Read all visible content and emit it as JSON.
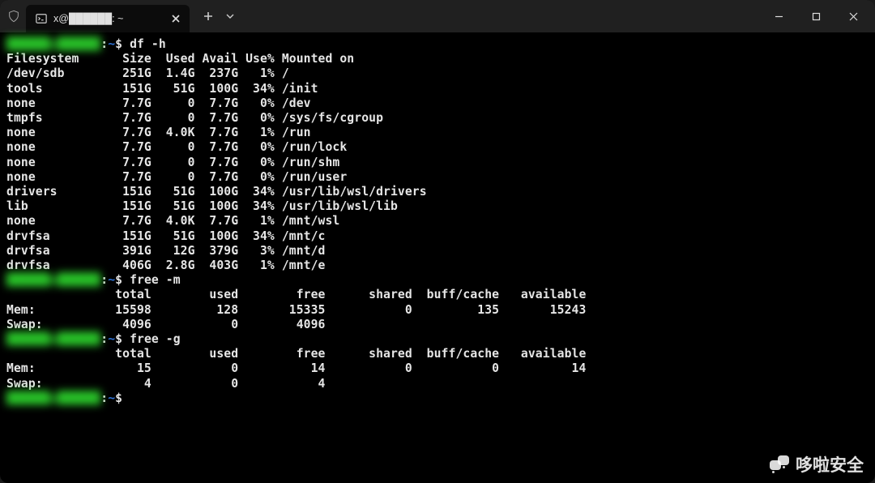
{
  "tab": {
    "title": "x@██████: ~"
  },
  "user": "██████",
  "host": "██████",
  "path": "~",
  "commands": {
    "c1": "df -h",
    "c2": "free -m",
    "c3": "free -g"
  },
  "df": {
    "header": [
      "Filesystem",
      "Size",
      "Used",
      "Avail",
      "Use%",
      "Mounted on"
    ],
    "rows": [
      {
        "fs": "/dev/sdb",
        "size": "251G",
        "used": "1.4G",
        "avail": "237G",
        "pct": "1%",
        "mnt": "/"
      },
      {
        "fs": "tools",
        "size": "151G",
        "used": "51G",
        "avail": "100G",
        "pct": "34%",
        "mnt": "/init"
      },
      {
        "fs": "none",
        "size": "7.7G",
        "used": "0",
        "avail": "7.7G",
        "pct": "0%",
        "mnt": "/dev"
      },
      {
        "fs": "tmpfs",
        "size": "7.7G",
        "used": "0",
        "avail": "7.7G",
        "pct": "0%",
        "mnt": "/sys/fs/cgroup"
      },
      {
        "fs": "none",
        "size": "7.7G",
        "used": "4.0K",
        "avail": "7.7G",
        "pct": "1%",
        "mnt": "/run"
      },
      {
        "fs": "none",
        "size": "7.7G",
        "used": "0",
        "avail": "7.7G",
        "pct": "0%",
        "mnt": "/run/lock"
      },
      {
        "fs": "none",
        "size": "7.7G",
        "used": "0",
        "avail": "7.7G",
        "pct": "0%",
        "mnt": "/run/shm"
      },
      {
        "fs": "none",
        "size": "7.7G",
        "used": "0",
        "avail": "7.7G",
        "pct": "0%",
        "mnt": "/run/user"
      },
      {
        "fs": "drivers",
        "size": "151G",
        "used": "51G",
        "avail": "100G",
        "pct": "34%",
        "mnt": "/usr/lib/wsl/drivers"
      },
      {
        "fs": "lib",
        "size": "151G",
        "used": "51G",
        "avail": "100G",
        "pct": "34%",
        "mnt": "/usr/lib/wsl/lib"
      },
      {
        "fs": "none",
        "size": "7.7G",
        "used": "4.0K",
        "avail": "7.7G",
        "pct": "1%",
        "mnt": "/mnt/wsl"
      },
      {
        "fs": "drvfsa",
        "size": "151G",
        "used": "51G",
        "avail": "100G",
        "pct": "34%",
        "mnt": "/mnt/c"
      },
      {
        "fs": "drvfsa",
        "size": "391G",
        "used": "12G",
        "avail": "379G",
        "pct": "3%",
        "mnt": "/mnt/d"
      },
      {
        "fs": "drvfsa",
        "size": "406G",
        "used": "2.8G",
        "avail": "403G",
        "pct": "1%",
        "mnt": "/mnt/e"
      }
    ]
  },
  "free_headers": [
    "total",
    "used",
    "free",
    "shared",
    "buff/cache",
    "available"
  ],
  "free_m": {
    "mem": {
      "label": "Mem:",
      "total": "15598",
      "used": "128",
      "free": "15335",
      "shared": "0",
      "buffcache": "135",
      "available": "15243"
    },
    "swap": {
      "label": "Swap:",
      "total": "4096",
      "used": "0",
      "free": "4096"
    }
  },
  "free_g": {
    "mem": {
      "label": "Mem:",
      "total": "15",
      "used": "0",
      "free": "14",
      "shared": "0",
      "buffcache": "0",
      "available": "14"
    },
    "swap": {
      "label": "Swap:",
      "total": "4",
      "used": "0",
      "free": "4"
    }
  },
  "watermark": "哆啦安全"
}
